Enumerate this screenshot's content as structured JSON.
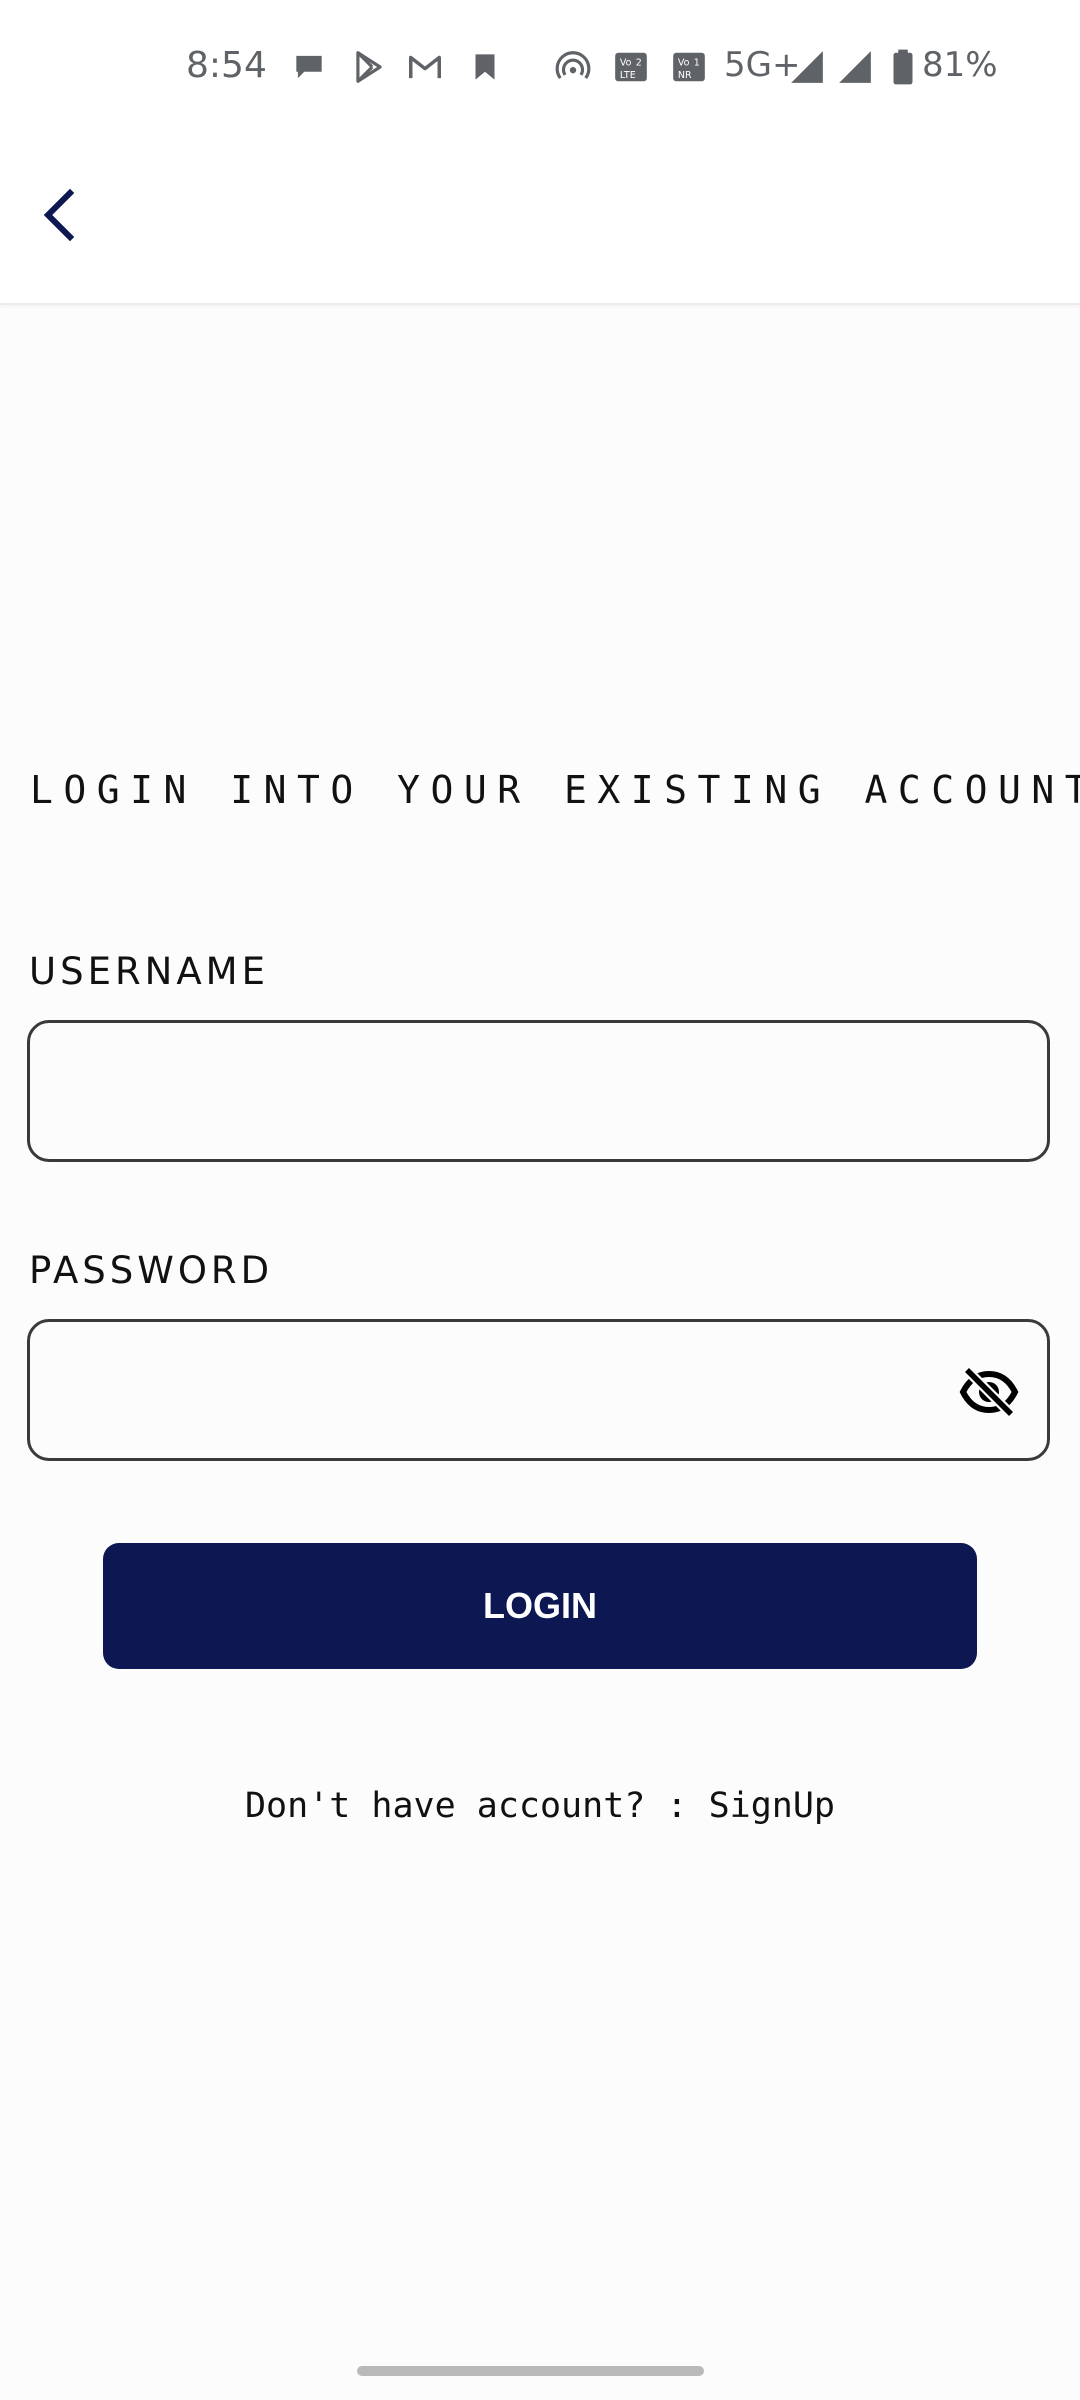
{
  "status_bar": {
    "time": "8:54",
    "network": "5G+",
    "battery": "81%",
    "icons": [
      "chat-bubble-icon",
      "play-store-icon",
      "gmail-icon",
      "bookmark-icon",
      "hotspot-icon",
      "volte-lte-icon",
      "vonr-icon",
      "signal-icon",
      "signal-icon",
      "battery-icon"
    ]
  },
  "app_bar": {
    "back_icon": "chevron-left-icon",
    "accent_color": "#0d1752"
  },
  "form": {
    "heading": "LOGIN INTO YOUR EXISTING ACCOUNT",
    "username_label": "USERNAME",
    "username_value": "",
    "password_label": "PASSWORD",
    "password_value": "",
    "password_toggle_icon": "eye-off-icon",
    "login_label": "LOGIN",
    "login_color": "#0d1752",
    "signup_prompt": "Don't have account? : ",
    "signup_link": "SignUp"
  }
}
